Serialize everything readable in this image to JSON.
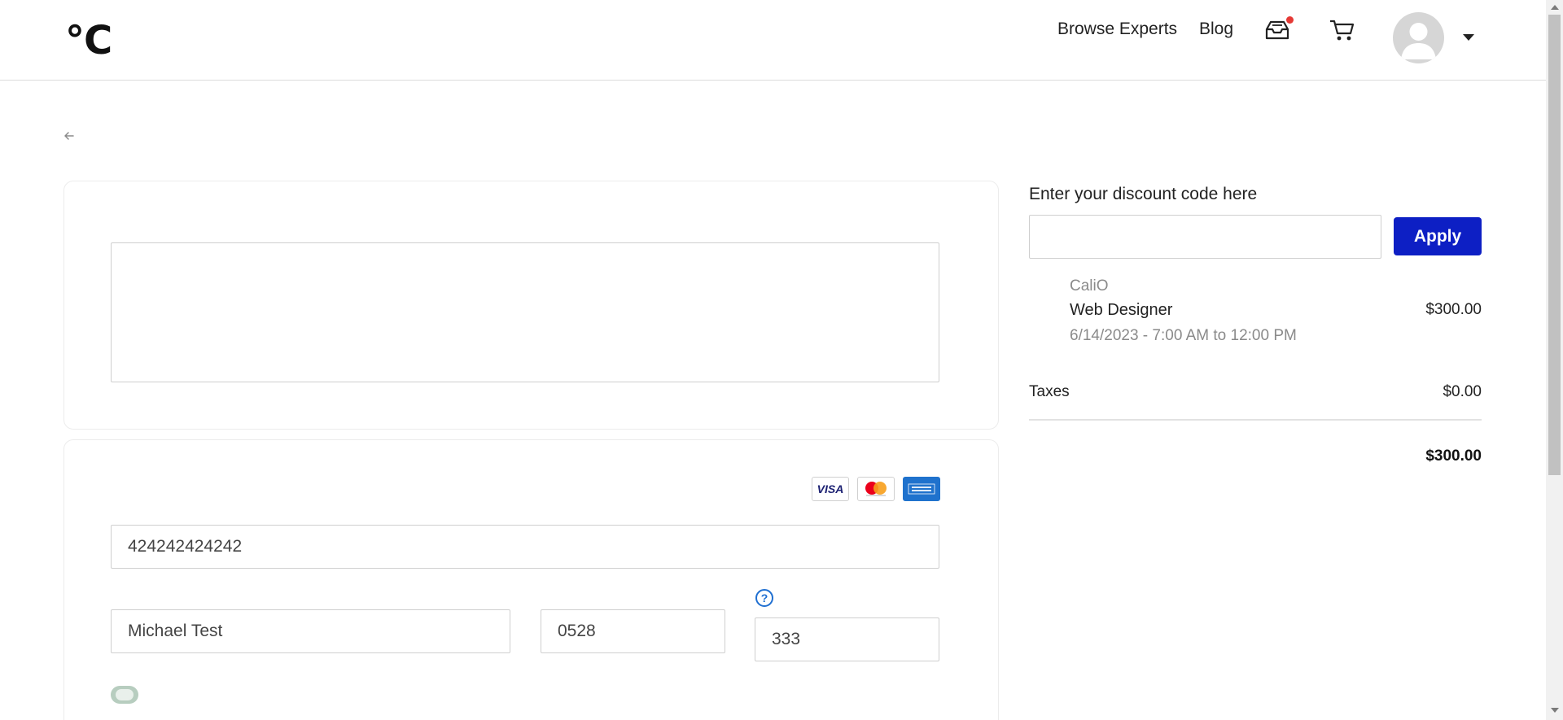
{
  "header": {
    "logo": "°C",
    "nav": {
      "browse_experts": "Browse Experts",
      "blog": "Blog"
    },
    "inbox_icon": "inbox-icon",
    "cart_icon": "cart-icon",
    "notification_color": "#e53935"
  },
  "payment": {
    "card_brands": [
      "visa",
      "mastercard",
      "amex"
    ],
    "card_number": "424242424242",
    "cardholder_name": "Michael Test",
    "expiry": "0528",
    "cvc": "333",
    "help_label": "?"
  },
  "summary": {
    "discount_label": "Enter your discount code here",
    "discount_value": "",
    "apply_label": "Apply",
    "accent_color": "#0d1fc4",
    "item": {
      "brand": "CaliO",
      "title": "Web Designer",
      "price": "$300.00",
      "date": "6/14/2023 - 7:00 AM to 12:00 PM"
    },
    "taxes_label": "Taxes",
    "taxes_value": "$0.00",
    "total": "$300.00"
  }
}
